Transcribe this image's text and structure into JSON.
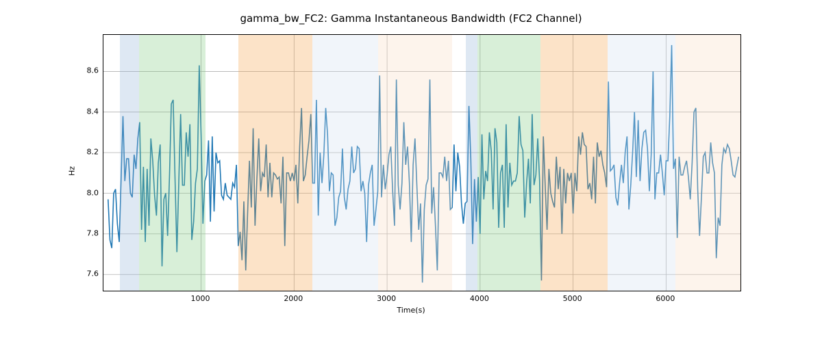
{
  "chart_data": {
    "type": "line",
    "title": "gamma_bw_FC2: Gamma Instantaneous Bandwidth (FC2 Channel)",
    "xlabel": "Time(s)",
    "ylabel": "Hz",
    "xlim": [
      -50,
      6800
    ],
    "ylim": [
      7.52,
      8.78
    ],
    "xticks": [
      1000,
      2000,
      3000,
      4000,
      5000,
      6000
    ],
    "yticks": [
      7.6,
      7.8,
      8.0,
      8.2,
      8.4,
      8.6
    ],
    "bands": [
      {
        "x0": 130,
        "x1": 330,
        "color": "blue"
      },
      {
        "x0": 330,
        "x1": 1050,
        "color": "green"
      },
      {
        "x0": 1400,
        "x1": 2200,
        "color": "orange"
      },
      {
        "x0": 2200,
        "x1": 2900,
        "color": "alice"
      },
      {
        "x0": 2900,
        "x1": 3700,
        "color": "linen"
      },
      {
        "x0": 3850,
        "x1": 3970,
        "color": "blue"
      },
      {
        "x0": 3970,
        "x1": 4650,
        "color": "green"
      },
      {
        "x0": 4650,
        "x1": 5370,
        "color": "orange"
      },
      {
        "x0": 5370,
        "x1": 6100,
        "color": "alice"
      },
      {
        "x0": 6100,
        "x1": 6800,
        "color": "linen"
      }
    ],
    "series": [
      {
        "name": "gamma_bw_FC2",
        "x_start": 0,
        "x_step": 20,
        "values": [
          7.97,
          7.77,
          7.73,
          8.0,
          8.02,
          7.85,
          7.76,
          8.07,
          8.38,
          8.06,
          8.17,
          8.17,
          8.0,
          7.98,
          8.19,
          8.12,
          8.27,
          8.35,
          7.82,
          8.13,
          7.76,
          8.12,
          7.84,
          8.27,
          8.16,
          7.99,
          7.89,
          8.15,
          8.24,
          7.64,
          7.97,
          8.0,
          7.79,
          8.08,
          8.44,
          8.46,
          8.07,
          7.71,
          8.05,
          8.39,
          8.04,
          8.04,
          8.3,
          8.18,
          8.34,
          7.77,
          7.86,
          8.05,
          8.12,
          8.63,
          8.29,
          7.85,
          8.06,
          8.09,
          8.26,
          7.86,
          8.28,
          7.91,
          8.2,
          8.15,
          8.16,
          7.99,
          7.97,
          8.05,
          7.99,
          7.98,
          7.97,
          8.05,
          8.03,
          8.14,
          7.74,
          7.81,
          7.67,
          7.96,
          7.62,
          7.9,
          8.16,
          7.93,
          8.32,
          7.84,
          8.07,
          8.27,
          8.01,
          8.1,
          8.08,
          8.24,
          7.98,
          8.15,
          7.98,
          8.1,
          8.09,
          8.07,
          8.08,
          7.95,
          8.18,
          7.74,
          8.1,
          8.1,
          8.06,
          8.1,
          8.06,
          8.14,
          7.95,
          8.23,
          8.42,
          8.06,
          8.09,
          8.18,
          8.26,
          8.39,
          8.05,
          8.05,
          8.46,
          7.89,
          8.2,
          8.05,
          8.19,
          8.42,
          8.29,
          8.01,
          8.1,
          8.09,
          7.84,
          7.88,
          7.98,
          8.01,
          8.22,
          7.98,
          7.92,
          8.02,
          8.06,
          8.23,
          8.1,
          8.12,
          8.23,
          8.22,
          8.01,
          8.06,
          8.0,
          7.76,
          8.04,
          8.1,
          8.14,
          7.84,
          7.92,
          8.01,
          8.58,
          7.98,
          8.14,
          8.02,
          8.09,
          8.19,
          8.23,
          8.01,
          7.84,
          8.56,
          8.04,
          7.92,
          8.05,
          8.35,
          8.14,
          8.23,
          8.05,
          7.76,
          8.14,
          8.27,
          8.04,
          7.82,
          7.95,
          7.56,
          7.92,
          8.04,
          8.07,
          8.56,
          7.9,
          8.03,
          7.84,
          7.62,
          8.1,
          8.1,
          8.08,
          8.18,
          8.06,
          8.16,
          7.92,
          7.93,
          8.24,
          8.01,
          8.2,
          8.13,
          7.95,
          7.85,
          7.95,
          7.96,
          8.43,
          8.17,
          7.75,
          8.07,
          7.86,
          8.08,
          7.8,
          8.29,
          7.97,
          8.11,
          8.06,
          8.3,
          8.21,
          7.92,
          8.32,
          8.25,
          7.83,
          8.1,
          8.14,
          7.83,
          8.34,
          7.93,
          8.15,
          8.04,
          8.06,
          8.06,
          8.1,
          8.38,
          8.24,
          8.21,
          7.88,
          8.05,
          8.17,
          7.95,
          8.39,
          8.04,
          8.09,
          8.27,
          8.06,
          7.57,
          8.28,
          8.04,
          7.82,
          8.12,
          8.0,
          7.96,
          7.93,
          8.18,
          8.02,
          8.13,
          7.8,
          8.12,
          7.95,
          8.1,
          8.06,
          8.1,
          7.9,
          8.1,
          8.01,
          8.28,
          8.19,
          8.3,
          8.24,
          8.23,
          8.02,
          8.05,
          7.97,
          8.18,
          7.95,
          8.25,
          8.18,
          8.21,
          8.14,
          8.1,
          8.03,
          8.55,
          8.11,
          8.12,
          8.14,
          7.98,
          7.94,
          8.05,
          8.14,
          8.05,
          8.2,
          8.28,
          7.92,
          8.04,
          8.2,
          8.4,
          8.08,
          8.36,
          8.06,
          8.22,
          8.3,
          8.31,
          8.22,
          8.01,
          8.19,
          8.6,
          7.97,
          8.1,
          8.1,
          8.19,
          8.1,
          7.99,
          8.16,
          8.16,
          8.38,
          8.73,
          8.12,
          8.17,
          7.78,
          8.18,
          8.09,
          8.09,
          8.13,
          8.16,
          8.08,
          7.97,
          8.15,
          8.4,
          8.42,
          8.02,
          7.79,
          7.98,
          8.18,
          8.2,
          8.1,
          8.1,
          8.25,
          8.15,
          8.1,
          7.68,
          7.88,
          7.84,
          8.14,
          8.22,
          8.2,
          8.24,
          8.22,
          8.16,
          8.09,
          8.08,
          8.13,
          8.18
        ]
      }
    ]
  }
}
